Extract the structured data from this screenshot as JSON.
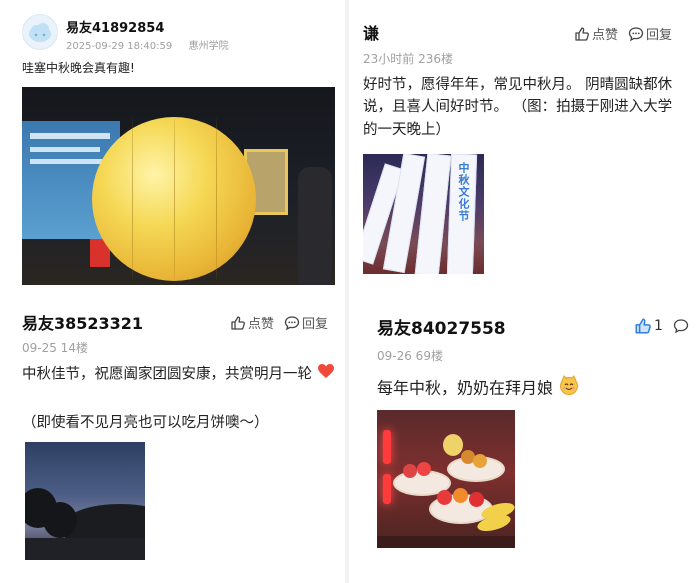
{
  "posts": [
    {
      "username": "易友41892854",
      "timestamp": "2025-09-29 18:40:59",
      "school": "惠州学院",
      "text": "哇塞中秋晚会真有趣!"
    },
    {
      "username": "谦",
      "meta": "23小时前 236楼",
      "like_label": "点赞",
      "reply_label": "回复",
      "text": "好时节，愿得年年，常见中秋月。 阴晴圆缺都休说，且喜人间好时节。 （图：拍摄于刚进入大学的一天晚上）",
      "ribbon_text": "中秋文化节"
    },
    {
      "username": "易友38523321",
      "meta": "09-25 14楼",
      "like_label": "点赞",
      "reply_label": "回复",
      "text_line1": "中秋佳节，祝愿阖家团圆安康，共赏明月一轮",
      "text_line2": "（即使看不见月亮也可以吃月饼噢～）"
    },
    {
      "username": "易友84027558",
      "meta": "09-26 69楼",
      "like_count": "1",
      "text": "每年中秋，奶奶在拜月娘"
    }
  ],
  "colors": {
    "accent_blue": "#2f7de1",
    "meta_gray": "#a0a0a0",
    "moon_yellow": "#f5d855",
    "heart_red": "#f04a3a"
  },
  "icons": {
    "like": "thumbs-up-icon",
    "reply": "comment-icon",
    "heart": "heart-emoji",
    "moon_face": "smiling-face-emoji",
    "avatar": "cloud-avatar-icon"
  }
}
